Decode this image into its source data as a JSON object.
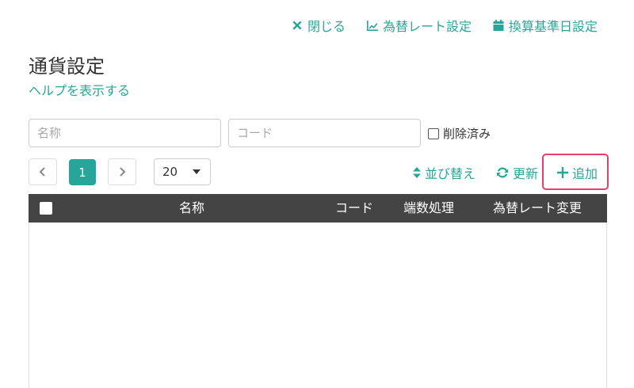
{
  "top_actions": {
    "close_label": "閉じる",
    "exchange_rate_label": "為替レート設定",
    "base_date_label": "換算基準日設定"
  },
  "page": {
    "title": "通貨設定",
    "help_link": "ヘルプを表示する"
  },
  "filters": {
    "name_placeholder": "名称",
    "code_placeholder": "コード",
    "deleted_label": "削除済み"
  },
  "pagination": {
    "current_page": "1",
    "per_page": "20"
  },
  "list_actions": {
    "sort_label": "並び替え",
    "refresh_label": "更新",
    "add_label": "追加"
  },
  "table": {
    "columns": [
      "名称",
      "コード",
      "端数処理",
      "為替レート変更"
    ],
    "rows": []
  },
  "colors": {
    "accent": "#26a69a",
    "header_bg": "#444444",
    "highlight": "#e83e6c"
  }
}
